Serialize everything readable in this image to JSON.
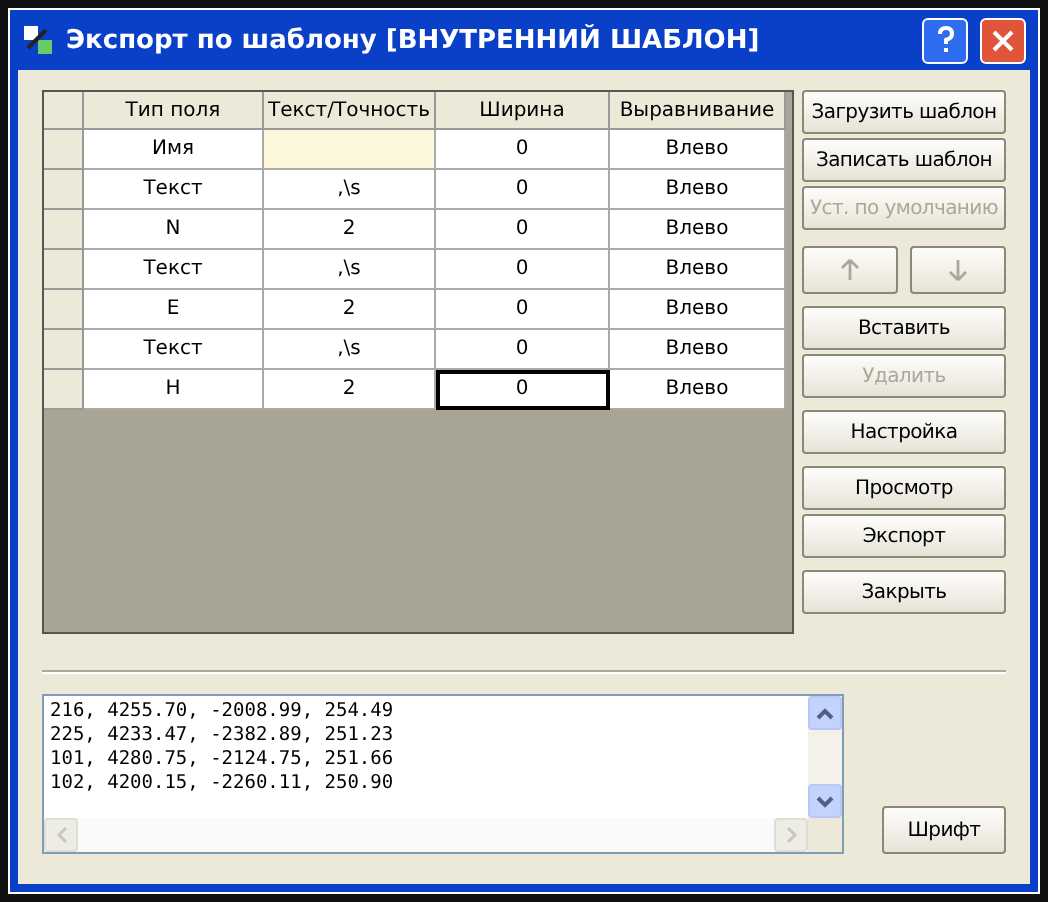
{
  "window": {
    "title": "Экспорт по шаблону  [ВНУТРЕННИЙ ШАБЛОН]"
  },
  "table": {
    "columns": [
      "Тип поля",
      "Текст/Точность",
      "Ширина",
      "Выравнивание"
    ],
    "rows": [
      {
        "cells": [
          {
            "text": "Имя",
            "selected": false,
            "highlighted": false
          },
          {
            "text": "",
            "selected": false,
            "highlighted": true
          },
          {
            "text": "0",
            "selected": false,
            "highlighted": false
          },
          {
            "text": "Влево",
            "selected": false,
            "highlighted": false
          }
        ]
      },
      {
        "cells": [
          {
            "text": "Текст",
            "selected": false,
            "highlighted": false
          },
          {
            "text": ",\\s",
            "selected": false,
            "highlighted": false
          },
          {
            "text": "0",
            "selected": false,
            "highlighted": false
          },
          {
            "text": "Влево",
            "selected": false,
            "highlighted": false
          }
        ]
      },
      {
        "cells": [
          {
            "text": "N",
            "selected": false,
            "highlighted": false
          },
          {
            "text": "2",
            "selected": false,
            "highlighted": false
          },
          {
            "text": "0",
            "selected": false,
            "highlighted": false
          },
          {
            "text": "Влево",
            "selected": false,
            "highlighted": false
          }
        ]
      },
      {
        "cells": [
          {
            "text": "Текст",
            "selected": false,
            "highlighted": false
          },
          {
            "text": ",\\s",
            "selected": false,
            "highlighted": false
          },
          {
            "text": "0",
            "selected": false,
            "highlighted": false
          },
          {
            "text": "Влево",
            "selected": false,
            "highlighted": false
          }
        ]
      },
      {
        "cells": [
          {
            "text": "E",
            "selected": false,
            "highlighted": false
          },
          {
            "text": "2",
            "selected": false,
            "highlighted": false
          },
          {
            "text": "0",
            "selected": false,
            "highlighted": false
          },
          {
            "text": "Влево",
            "selected": false,
            "highlighted": false
          }
        ]
      },
      {
        "cells": [
          {
            "text": "Текст",
            "selected": false,
            "highlighted": false
          },
          {
            "text": ",\\s",
            "selected": false,
            "highlighted": false
          },
          {
            "text": "0",
            "selected": false,
            "highlighted": false
          },
          {
            "text": "Влево",
            "selected": false,
            "highlighted": false
          }
        ]
      },
      {
        "cells": [
          {
            "text": "H",
            "selected": false,
            "highlighted": false
          },
          {
            "text": "2",
            "selected": false,
            "highlighted": false
          },
          {
            "text": "0",
            "selected": true,
            "highlighted": false
          },
          {
            "text": "Влево",
            "selected": false,
            "highlighted": false
          }
        ]
      }
    ]
  },
  "button_groups": [
    [
      {
        "kind": "text",
        "label": "Загрузить шаблон",
        "disabled": false
      },
      {
        "kind": "text",
        "label": "Записать шаблон",
        "disabled": false
      },
      {
        "kind": "text",
        "label": "Уст. по умолчанию",
        "disabled": true
      }
    ],
    [
      {
        "kind": "arrow-up",
        "disabled": true
      },
      {
        "kind": "arrow-down",
        "disabled": true
      }
    ],
    [
      {
        "kind": "text",
        "label": "Вставить",
        "disabled": false
      },
      {
        "kind": "text",
        "label": "Удалить",
        "disabled": true
      }
    ],
    [
      {
        "kind": "text",
        "label": "Настройка",
        "disabled": false
      }
    ],
    [
      {
        "kind": "text",
        "label": "Просмотр",
        "disabled": false
      },
      {
        "kind": "text",
        "label": "Экспорт",
        "disabled": false
      }
    ],
    [
      {
        "kind": "text",
        "label": "Закрыть",
        "disabled": false
      }
    ]
  ],
  "output": {
    "lines": [
      "216, 4255.70, -2008.99, 254.49",
      "225, 4233.47, -2382.89, 251.23",
      "101, 4280.75, -2124.75, 251.66",
      "102, 4200.15, -2260.11, 250.90"
    ]
  },
  "font_button": {
    "label": "Шрифт"
  }
}
